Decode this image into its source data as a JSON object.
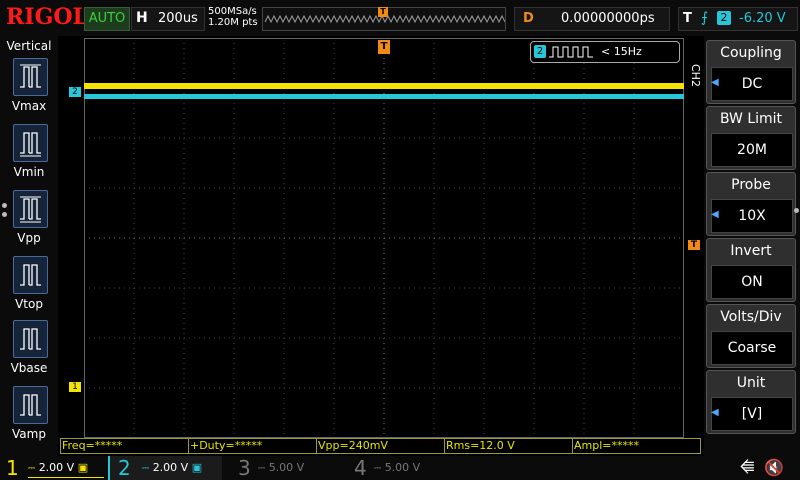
{
  "header": {
    "brand": "RIGOL",
    "auto_label": "AUTO",
    "horizontal": {
      "letter": "H",
      "value": "200us"
    },
    "sample_rate": "500MSa/s",
    "memory_depth": "1.20M pts",
    "trigger_marker": "T",
    "delay": {
      "letter": "D",
      "value": "0.00000000ps"
    },
    "trigger": {
      "letter": "T",
      "slope_icon": "rising-edge-icon",
      "source": "2",
      "level": "-6.20 V"
    }
  },
  "left_menu": {
    "title": "Vertical",
    "items": [
      {
        "label": "Vmax"
      },
      {
        "label": "Vmin"
      },
      {
        "label": "Vpp"
      },
      {
        "label": "Vtop"
      },
      {
        "label": "Vbase"
      },
      {
        "label": "Vamp"
      }
    ]
  },
  "plot": {
    "ch2_marker": "2",
    "ch1_marker": "1",
    "trigger_top_marker": "T",
    "trigger_level_marker": "T",
    "freq_badge": {
      "channel": "2",
      "text": "< 15Hz"
    },
    "colors": {
      "ch1": "#f5e400",
      "ch2": "#24c8d8",
      "trigger": "#f08a14",
      "grid": "#555555"
    }
  },
  "right_menu": {
    "channel_label": "CH2",
    "items": [
      {
        "title": "Coupling",
        "value": "DC"
      },
      {
        "title": "BW Limit",
        "value": "20M"
      },
      {
        "title": "Probe",
        "value": "10X"
      },
      {
        "title": "Invert",
        "value": "ON"
      },
      {
        "title": "Volts/Div",
        "value": "Coarse"
      },
      {
        "title": "Unit",
        "value": "[V]"
      }
    ]
  },
  "measurements": [
    "Freq=*****",
    "+Duty=*****",
    "Vpp=240mV",
    "Rms=12.0 V",
    "Ampl=*****"
  ],
  "channels": [
    {
      "num": "1",
      "scale": "2.00 V",
      "color": "#f5e400"
    },
    {
      "num": "2",
      "scale": "2.00 V",
      "color": "#24c8d8"
    },
    {
      "num": "3",
      "scale": "5.00 V",
      "color": "#777777"
    },
    {
      "num": "4",
      "scale": "5.00 V",
      "color": "#777777"
    }
  ],
  "status_icons": [
    "usb-icon",
    "speaker-muted-icon"
  ]
}
